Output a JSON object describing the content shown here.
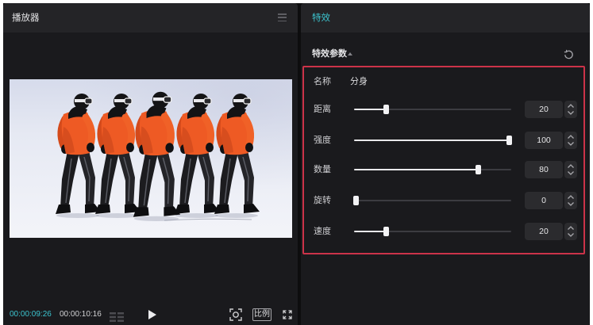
{
  "player": {
    "title": "播放器",
    "current_time": "00:00:09:26",
    "total_time": "00:00:10:16",
    "ratio_label": "比例"
  },
  "effects": {
    "tab_title": "特效",
    "section_title": "特效参数",
    "name_label": "名称",
    "name_value": "分身",
    "params": [
      {
        "label": "距离",
        "value": 20
      },
      {
        "label": "强度",
        "value": 100
      },
      {
        "label": "数量",
        "value": 80
      },
      {
        "label": "旋转",
        "value": 0
      },
      {
        "label": "速度",
        "value": 20
      }
    ]
  },
  "icons": {
    "menu": "menu-icon",
    "frames": "frame-grid-icon",
    "play": "play-icon",
    "snapshot": "snapshot-icon",
    "fullscreen": "fullscreen-icon",
    "collapse": "collapse-arrow-icon",
    "reset": "reset-icon",
    "step_up": "chevron-up-icon",
    "step_down": "chevron-down-icon"
  },
  "colors": {
    "accent": "#3cc4cf",
    "highlight": "#cc3349"
  }
}
